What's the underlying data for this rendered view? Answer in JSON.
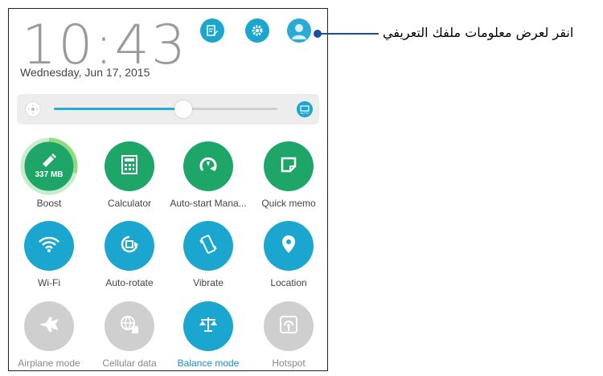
{
  "status": {
    "time": "10:43",
    "date": "Wednesday, Jun 17, 2015"
  },
  "header_icons": [
    "edit-icon",
    "settings-icon",
    "profile-icon"
  ],
  "brightness": {
    "level": 0.58,
    "auto_label": "AUTO"
  },
  "tiles": [
    {
      "label": "Boost",
      "icon": "broom-icon",
      "badge": "337 MB",
      "color": "#1ea669"
    },
    {
      "label": "Calculator",
      "icon": "calculator-icon",
      "color": "#1ea669"
    },
    {
      "label": "Auto-start Mana...",
      "icon": "auto-start-icon",
      "color": "#1ea669"
    },
    {
      "label": "Quick memo",
      "icon": "memo-icon",
      "color": "#1ea669"
    },
    {
      "label": "Wi-Fi",
      "icon": "wifi-icon",
      "color": "#1aa6cf"
    },
    {
      "label": "Auto-rotate",
      "icon": "rotate-icon",
      "color": "#1aa6cf"
    },
    {
      "label": "Vibrate",
      "icon": "vibrate-icon",
      "color": "#1aa6cf"
    },
    {
      "label": "Location",
      "icon": "location-icon",
      "color": "#1aa6cf"
    },
    {
      "label": "Airplane mode",
      "icon": "airplane-icon",
      "color": "#cfcfcf"
    },
    {
      "label": "Cellular data",
      "icon": "globe-icon",
      "color": "#cfcfcf"
    },
    {
      "label": "Balance mode",
      "icon": "balance-icon",
      "color": "#1aa6cf"
    },
    {
      "label": "Hotspot",
      "icon": "hotspot-icon",
      "color": "#cfcfcf"
    }
  ],
  "callout": {
    "text": "انقر لعرض معلومات ملفك التعريفي"
  }
}
